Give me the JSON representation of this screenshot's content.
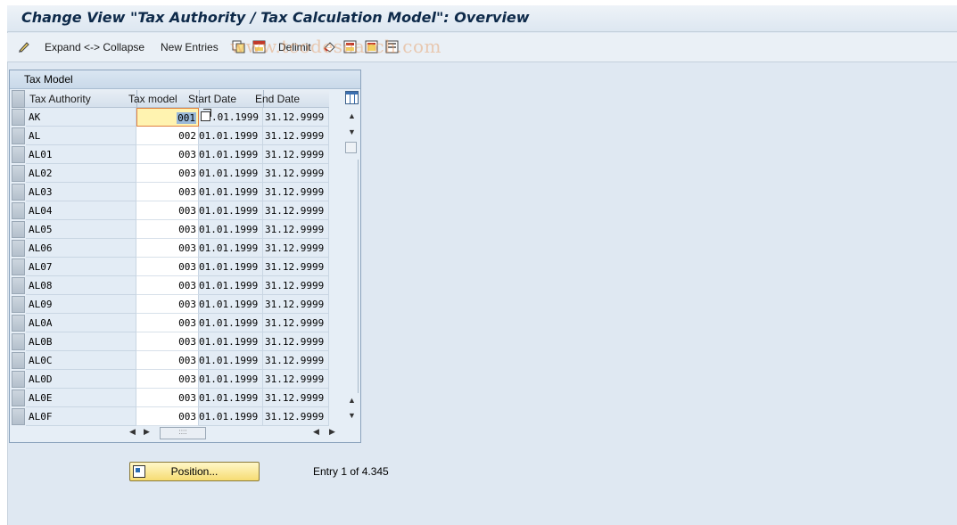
{
  "window": {
    "title": "Change View \"Tax Authority / Tax Calculation Model\": Overview"
  },
  "toolbar": {
    "expand_collapse": "Expand <-> Collapse",
    "new_entries": "New Entries",
    "delimit": "Delimit",
    "watermark": "www.tcodesearch.com"
  },
  "panel": {
    "title": "Tax Model"
  },
  "table": {
    "columns": [
      "Tax Authority",
      "Tax model",
      "Start Date",
      "End Date"
    ],
    "rows": [
      {
        "authority": "AK",
        "model": "001",
        "start": ".01.1999",
        "end": "31.12.9999"
      },
      {
        "authority": "AL",
        "model": "002",
        "start": "01.01.1999",
        "end": "31.12.9999"
      },
      {
        "authority": "AL01",
        "model": "003",
        "start": "01.01.1999",
        "end": "31.12.9999"
      },
      {
        "authority": "AL02",
        "model": "003",
        "start": "01.01.1999",
        "end": "31.12.9999"
      },
      {
        "authority": "AL03",
        "model": "003",
        "start": "01.01.1999",
        "end": "31.12.9999"
      },
      {
        "authority": "AL04",
        "model": "003",
        "start": "01.01.1999",
        "end": "31.12.9999"
      },
      {
        "authority": "AL05",
        "model": "003",
        "start": "01.01.1999",
        "end": "31.12.9999"
      },
      {
        "authority": "AL06",
        "model": "003",
        "start": "01.01.1999",
        "end": "31.12.9999"
      },
      {
        "authority": "AL07",
        "model": "003",
        "start": "01.01.1999",
        "end": "31.12.9999"
      },
      {
        "authority": "AL08",
        "model": "003",
        "start": "01.01.1999",
        "end": "31.12.9999"
      },
      {
        "authority": "AL09",
        "model": "003",
        "start": "01.01.1999",
        "end": "31.12.9999"
      },
      {
        "authority": "AL0A",
        "model": "003",
        "start": "01.01.1999",
        "end": "31.12.9999"
      },
      {
        "authority": "AL0B",
        "model": "003",
        "start": "01.01.1999",
        "end": "31.12.9999"
      },
      {
        "authority": "AL0C",
        "model": "003",
        "start": "01.01.1999",
        "end": "31.12.9999"
      },
      {
        "authority": "AL0D",
        "model": "003",
        "start": "01.01.1999",
        "end": "31.12.9999"
      },
      {
        "authority": "AL0E",
        "model": "003",
        "start": "01.01.1999",
        "end": "31.12.9999"
      },
      {
        "authority": "AL0F",
        "model": "003",
        "start": "01.01.1999",
        "end": "31.12.9999"
      }
    ]
  },
  "footer": {
    "position_label": "Position...",
    "entry_text": "Entry 1 of 4.345"
  }
}
